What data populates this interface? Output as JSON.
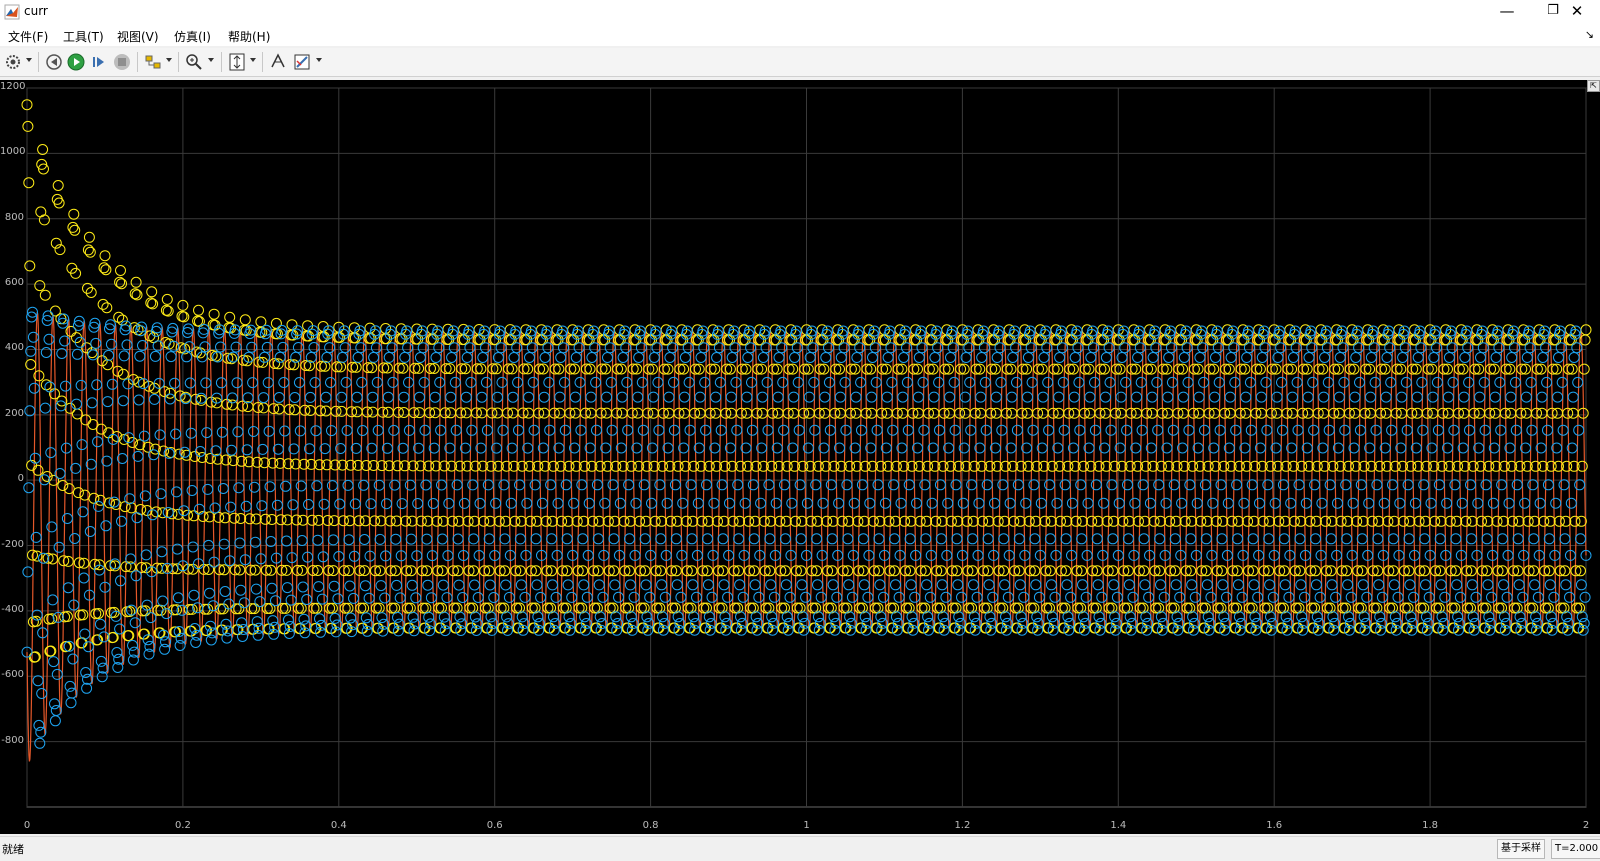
{
  "window": {
    "title": "curr",
    "minimize_label": "—",
    "restore_label": "❐",
    "close_label": "✕"
  },
  "menu": [
    {
      "label": "文件(F)"
    },
    {
      "label": "工具(T)"
    },
    {
      "label": "视图(V)"
    },
    {
      "label": "仿真(I)"
    },
    {
      "label": "帮助(H)"
    }
  ],
  "toolbar": {
    "icons": [
      "settings-icon",
      "step-back-icon",
      "run-icon",
      "step-forward-icon",
      "stop-icon",
      "signal-select-icon",
      "zoom-icon",
      "autoscale-icon",
      "cursor-measure-icon",
      "highlight-icon"
    ]
  },
  "chart_data": {
    "type": "line",
    "xlim": [
      0,
      2
    ],
    "ylim": [
      -1000,
      1200
    ],
    "xticks": [
      "0",
      "0.2",
      "0.4",
      "0.6",
      "0.8",
      "1",
      "1.2",
      "1.4",
      "1.6",
      "1.8",
      "2"
    ],
    "yticks": [
      "1200",
      "1000",
      "800",
      "600",
      "400",
      "200",
      "0",
      "-200",
      "-400",
      "-600",
      "-800"
    ],
    "grid": true,
    "background": "#000000",
    "steady_state_amplitude": 460,
    "frequency_hz": 50,
    "series": [
      {
        "color": "#fdea17",
        "marker": "circle",
        "phase_deg": 0,
        "peak_early": 990
      },
      {
        "color": "#1ea3f0",
        "marker": "circle",
        "phase_deg": -120,
        "peak_early": -780
      },
      {
        "color": "#e5582a",
        "marker": "none",
        "phase_deg": 120,
        "peak_early": -780
      }
    ]
  },
  "status": {
    "text": "就绪",
    "mode": "基于采样",
    "time": "T=2.000"
  }
}
